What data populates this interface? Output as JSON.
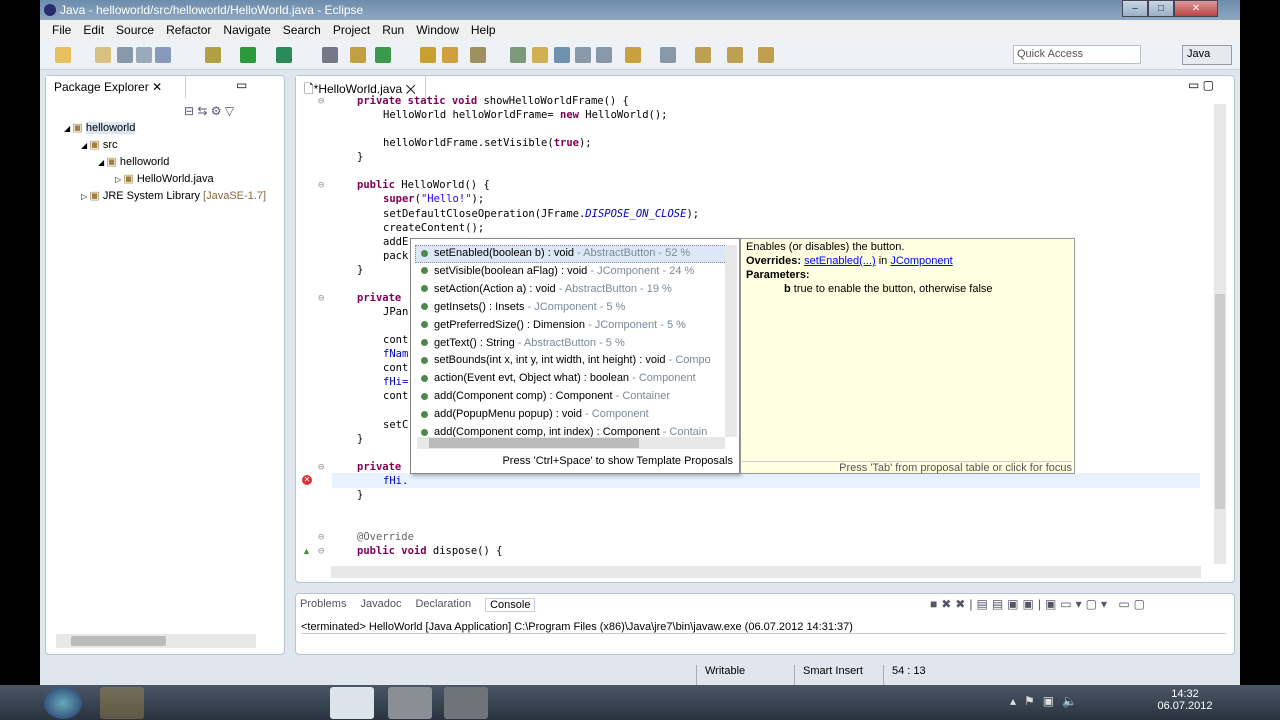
{
  "window": {
    "title": "Java - helloworld/src/helloworld/HelloWorld.java - Eclipse"
  },
  "menu": [
    "File",
    "Edit",
    "Source",
    "Refactor",
    "Navigate",
    "Search",
    "Project",
    "Run",
    "Window",
    "Help"
  ],
  "toolbar": {
    "quick_access_placeholder": "Quick Access",
    "perspective": "Java"
  },
  "package_explorer": {
    "title": "Package Explorer",
    "tree": [
      {
        "label": "helloworld",
        "depth": 0,
        "icon": "project-icon"
      },
      {
        "label": "src",
        "depth": 1,
        "icon": "source-folder-icon"
      },
      {
        "label": "helloworld",
        "depth": 2,
        "icon": "package-icon"
      },
      {
        "label": "HelloWorld.java",
        "depth": 3,
        "icon": "java-file-icon"
      },
      {
        "label": "JRE System Library",
        "suffix": "[JavaSE-1.7]",
        "depth": 1,
        "icon": "library-icon"
      }
    ]
  },
  "editor": {
    "tab": "*HelloWorld.java",
    "lines": [
      {
        "i": 1,
        "t": "private static void showHelloWorldFrame() {"
      },
      {
        "i": 2,
        "t": "HelloWorld helloWorldFrame= new HelloWorld();"
      },
      {
        "i": 0,
        "t": ""
      },
      {
        "i": 2,
        "t": "helloWorldFrame.setVisible(true);"
      },
      {
        "i": 1,
        "t": "}"
      },
      {
        "i": 0,
        "t": ""
      },
      {
        "i": 1,
        "t": "public HelloWorld() {"
      },
      {
        "i": 2,
        "t": "super(\"Hello!\");"
      },
      {
        "i": 2,
        "t": "setDefaultCloseOperation(JFrame.DISPOSE_ON_CLOSE);"
      },
      {
        "i": 2,
        "t": "createContent();"
      },
      {
        "i": 2,
        "t": "addE"
      },
      {
        "i": 2,
        "t": "pack"
      },
      {
        "i": 1,
        "t": "}"
      },
      {
        "i": 0,
        "t": ""
      },
      {
        "i": 1,
        "t": "private"
      },
      {
        "i": 2,
        "t": "JPan"
      },
      {
        "i": 0,
        "t": ""
      },
      {
        "i": 2,
        "t": "cont"
      },
      {
        "i": 2,
        "t": "fNam"
      },
      {
        "i": 2,
        "t": "cont"
      },
      {
        "i": 2,
        "t": "fHi="
      },
      {
        "i": 2,
        "t": "cont"
      },
      {
        "i": 0,
        "t": ""
      },
      {
        "i": 2,
        "t": "setC"
      },
      {
        "i": 1,
        "t": "}"
      },
      {
        "i": 0,
        "t": ""
      },
      {
        "i": 1,
        "t": "private"
      },
      {
        "i": 2,
        "t": "fHi."
      },
      {
        "i": 1,
        "t": "}"
      },
      {
        "i": 0,
        "t": ""
      },
      {
        "i": 0,
        "t": ""
      },
      {
        "i": 1,
        "t": "@Override"
      },
      {
        "i": 1,
        "t": "public void dispose() {"
      }
    ]
  },
  "proposals": {
    "items": [
      {
        "sig": "setEnabled(boolean b) : void",
        "owner": "AbstractButton - 52 %"
      },
      {
        "sig": "setVisible(boolean aFlag) : void",
        "owner": "JComponent - 24 %"
      },
      {
        "sig": "setAction(Action a) : void",
        "owner": "AbstractButton - 19 %"
      },
      {
        "sig": "getInsets() : Insets",
        "owner": "JComponent - 5 %"
      },
      {
        "sig": "getPreferredSize() : Dimension",
        "owner": "JComponent - 5 %"
      },
      {
        "sig": "getText() : String",
        "owner": "AbstractButton - 5 %"
      },
      {
        "sig": "setBounds(int x, int y, int width, int height) : void",
        "owner": "Compo"
      },
      {
        "sig": "action(Event evt, Object what) : boolean",
        "owner": "Component"
      },
      {
        "sig": "add(Component comp) : Component",
        "owner": "Container"
      },
      {
        "sig": "add(PopupMenu popup) : void",
        "owner": "Component"
      },
      {
        "sig": "add(Component comp, int index) : Component",
        "owner": "Contain"
      }
    ],
    "footer": "Press 'Ctrl+Space' to show Template Proposals"
  },
  "javadoc": {
    "summary": "Enables (or disables) the button.",
    "overrides_label": "Overrides:",
    "overrides_link": "setEnabled(...)",
    "in": "in",
    "class_link": "JComponent",
    "params_label": "Parameters:",
    "param_name": "b",
    "param_desc": "true to enable the button, otherwise false",
    "footer": "Press 'Tab' from proposal table or click for focus"
  },
  "bottom": {
    "tabs": [
      "Problems",
      "Javadoc",
      "Declaration",
      "Console"
    ],
    "console_text": "<terminated> HelloWorld [Java Application] C:\\Program Files (x86)\\Java\\jre7\\bin\\javaw.exe (06.07.2012 14:31:37)"
  },
  "status": {
    "writable": "Writable",
    "insert": "Smart Insert",
    "position": "54 : 13"
  },
  "clock": {
    "time": "14:32",
    "date": "06.07.2012"
  }
}
